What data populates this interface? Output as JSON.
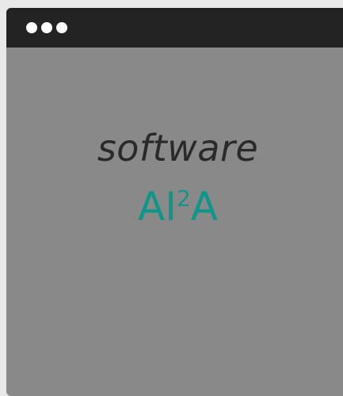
{
  "window": {
    "titlebar": {
      "dots": 3
    }
  },
  "content": {
    "word": "software",
    "brand_base": "AI",
    "brand_sup": "2",
    "brand_tail": "A"
  },
  "colors": {
    "background": "#e9e9e9",
    "window": "#898989",
    "titlebar": "#232323",
    "brand": "#0d968a",
    "word": "#2a2a2a"
  }
}
